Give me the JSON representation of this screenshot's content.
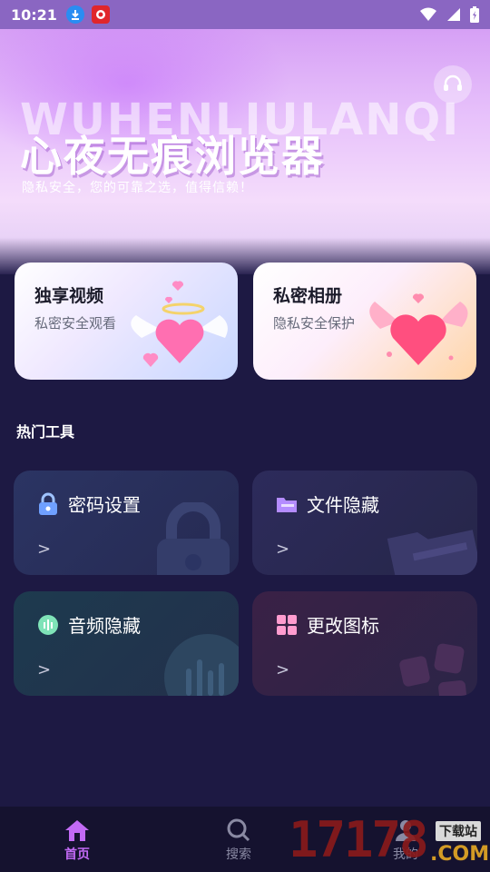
{
  "status_bar": {
    "time": "10:21",
    "icons": [
      "download-icon",
      "app-notification-icon",
      "wifi-icon",
      "signal-icon",
      "battery-icon"
    ]
  },
  "hero": {
    "watermark_text": "WUHENLIULANQI",
    "title": "心夜无痕浏览器",
    "subtitle": "隐私安全，您的可靠之选，值得信赖！",
    "support_icon": "headset-icon"
  },
  "features": [
    {
      "title": "独享视频",
      "subtitle": "私密安全观看",
      "art": "winged-heart-blue"
    },
    {
      "title": "私密相册",
      "subtitle": "隐私安全保护",
      "art": "winged-heart-pink"
    }
  ],
  "section": {
    "title": "热门工具"
  },
  "tools": [
    {
      "label": "密码设置",
      "icon": "lock-icon",
      "chevron": ">"
    },
    {
      "label": "文件隐藏",
      "icon": "folder-icon",
      "chevron": ">"
    },
    {
      "label": "音频隐藏",
      "icon": "audio-icon",
      "chevron": ">"
    },
    {
      "label": "更改图标",
      "icon": "apps-icon",
      "chevron": ">"
    }
  ],
  "bottom_nav": [
    {
      "label": "首页",
      "icon": "home-icon",
      "active": true
    },
    {
      "label": "搜索",
      "icon": "search-icon",
      "active": false
    },
    {
      "label": "我的",
      "icon": "profile-icon",
      "active": false
    }
  ],
  "watermark": {
    "number": "17178",
    "tag": "下载站",
    "domain": ".COM"
  },
  "colors": {
    "accent": "#c26af5",
    "background": "#1d1943"
  }
}
